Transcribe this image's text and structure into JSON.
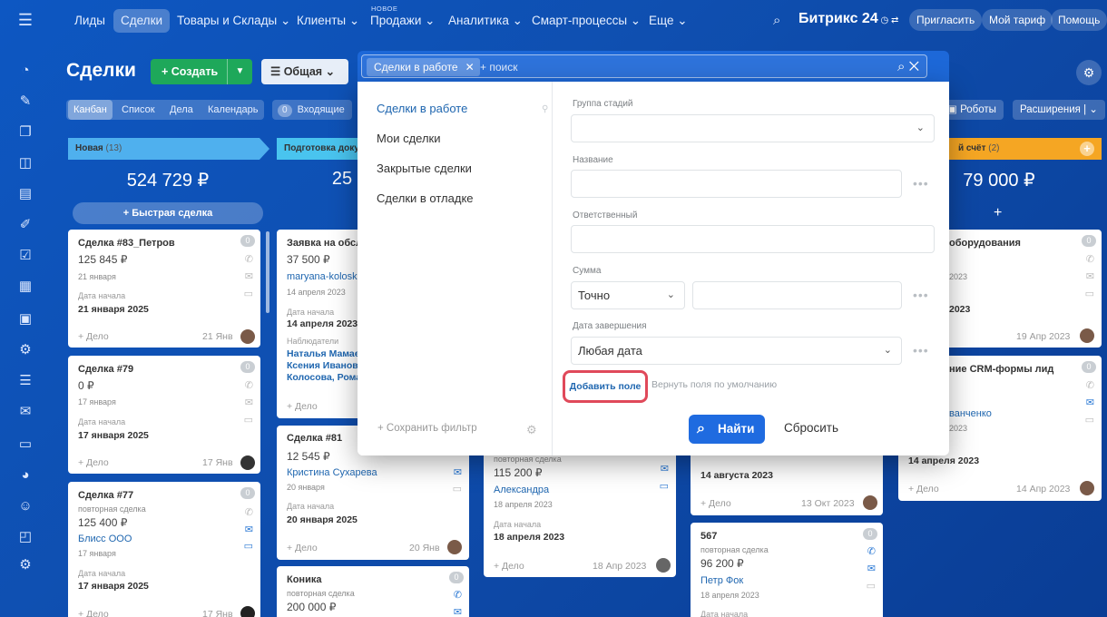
{
  "topnav": {
    "menu_icon": "hamburger-icon",
    "items": [
      "Лиды",
      "Сделки",
      "Товары и Склады",
      "Клиенты",
      "Продажи",
      "Аналитика",
      "Смарт-процессы",
      "Еще"
    ],
    "new_badge": "НОВОЕ",
    "brand": "Битрикс 24",
    "invite": "Пригласить",
    "tariff": "Мой тариф",
    "help": "Помощь"
  },
  "header": {
    "title": "Сделки",
    "create": "Создать",
    "category": "Общая",
    "view_tabs": [
      "Канбан",
      "Список",
      "Дела",
      "Календарь"
    ],
    "inbox_count": "0",
    "inbox_label": "Входящие",
    "robots": "Роботы",
    "extensions": "Расширения"
  },
  "stages": [
    {
      "name": "Новая",
      "count": "(13)",
      "sum": "524 729 ₽",
      "color": "#3aa8ea"
    },
    {
      "name": "Подготовка доку",
      "count": "",
      "sum": "25",
      "color": "#3fc2ee"
    },
    {
      "name": "й счёт",
      "count": "(2)",
      "sum": "79 000 ₽",
      "color": "#f5a623"
    }
  ],
  "quick_deal": "Быстрая сделка",
  "cards": {
    "c1": {
      "title": "Сделка #83_Петров",
      "amount": "125 845 ₽",
      "sub": "21 января",
      "start_label": "Дата начала",
      "start": "21 января 2025",
      "deal": "+ Дело",
      "date": "21 Янв",
      "badge": "0"
    },
    "c2": {
      "title": "Сделка #79",
      "amount": "0 ₽",
      "sub": "17 января",
      "start_label": "Дата начала",
      "start": "17 января 2025",
      "deal": "+ Дело",
      "date": "17 Янв",
      "badge": "0"
    },
    "c3": {
      "title": "Сделка #77",
      "kind": "повторная сделка",
      "amount": "125 400 ₽",
      "client": "Блисс ООО",
      "sub": "17 января",
      "start_label": "Дата начала",
      "start": "17 января 2025",
      "deal": "+ Дело",
      "date": "17 Янв",
      "badge": "0"
    },
    "c4": {
      "title": "Заявка на обсл",
      "amount": "37 500 ₽",
      "client": "maryana-kolosk",
      "sub": "14 апреля 2023",
      "start_label": "Дата начала",
      "start": "14 апреля 2023",
      "obs_label": "Наблюдатели",
      "obs": [
        "Наталья Мамаев",
        "Ксения Иванова",
        "Колосова, Рома"
      ],
      "deal": "+ Дело"
    },
    "c5": {
      "title": "Сделка #81",
      "amount": "12 545 ₽",
      "client": "Кристина Сухарева",
      "sub": "20 января",
      "start_label": "Дата начала",
      "start": "20 января 2025",
      "deal": "+ Дело",
      "date": "20 Янв"
    },
    "c6": {
      "title": "Коника",
      "kind": "повторная сделка",
      "amount": "200 000 ₽",
      "badge": "0"
    },
    "c7": {
      "kind": "повторная сделка",
      "amount": "115 200 ₽",
      "client": "Александра",
      "sub": "18 апреля 2023",
      "start_label": "Дата начала",
      "start": "18 апреля 2023",
      "deal": "+ Дело",
      "date": "18 Апр 2023"
    },
    "c8": {
      "start": "14 августа 2023",
      "deal": "+ Дело",
      "date": "13 Окт 2023"
    },
    "c9": {
      "title": "567",
      "kind": "повторная сделка",
      "amount": "96 200 ₽",
      "client": "Петр Фок",
      "sub": "18 апреля 2023",
      "start_label": "Дата начала",
      "badge": "0"
    },
    "c10": {
      "title": "оборудования",
      "sub": "2023",
      "start": "2023",
      "date": "19 Апр 2023",
      "badge": "0"
    },
    "c11": {
      "title": "ние CRM-формы лид",
      "client": "ванченко",
      "sub": "2023",
      "start": "14 апреля 2023",
      "deal": "+ Дело",
      "date": "14 Апр 2023",
      "badge": "0"
    }
  },
  "filter": {
    "chip": "Сделки в работе",
    "placeholder": "+ поиск",
    "presets": [
      "Сделки в работе",
      "Мои сделки",
      "Закрытые сделки",
      "Сделки в отладке"
    ],
    "save_filter": "Сохранить фильтр",
    "fields": {
      "stage_group": {
        "label": "Группа стадий",
        "value": ""
      },
      "name": {
        "label": "Название",
        "value": ""
      },
      "responsible": {
        "label": "Ответственный",
        "value": ""
      },
      "sum": {
        "label": "Сумма",
        "mode": "Точно",
        "value": ""
      },
      "close_date": {
        "label": "Дата завершения",
        "value": "Любая дата"
      }
    },
    "add_field": "Добавить поле",
    "restore_defaults": "Вернуть поля по умолчанию",
    "find": "Найти",
    "reset": "Сбросить"
  },
  "colors": {
    "accent": "#1f6be0",
    "highlight": "#e0495a",
    "create": "#1ea85a"
  }
}
